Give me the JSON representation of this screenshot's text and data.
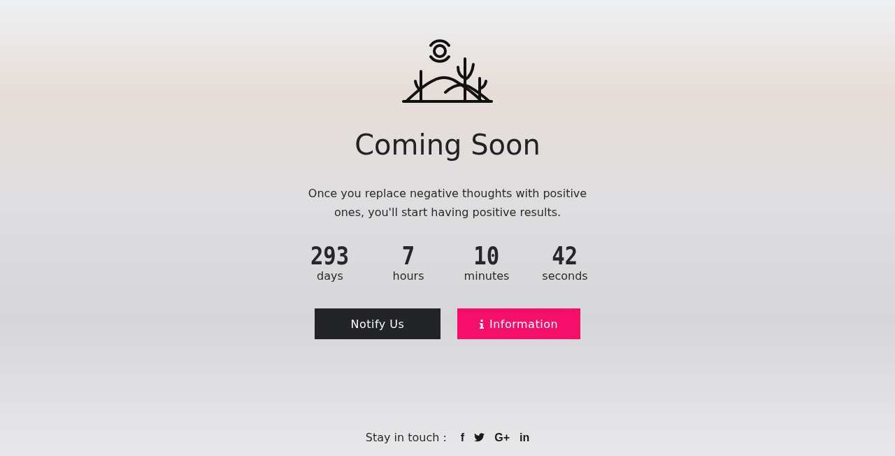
{
  "title": "Coming Soon",
  "message": "Once you replace negative thoughts with positive ones, you'll start having positive results.",
  "countdown": [
    {
      "value": "293",
      "unit": "days"
    },
    {
      "value": "7",
      "unit": "hours"
    },
    {
      "value": "10",
      "unit": "minutes"
    },
    {
      "value": "42",
      "unit": "seconds"
    }
  ],
  "buttons": [
    {
      "label": "Notify Us",
      "kind": "dark"
    },
    {
      "label": "Information",
      "kind": "accent"
    }
  ],
  "footer": {
    "label": "Stay in touch :",
    "social": [
      {
        "kind": "text",
        "glyph": "f"
      },
      {
        "kind": "bird"
      },
      {
        "kind": "text",
        "glyph": "G+"
      },
      {
        "kind": "text",
        "glyph": "in"
      }
    ]
  }
}
